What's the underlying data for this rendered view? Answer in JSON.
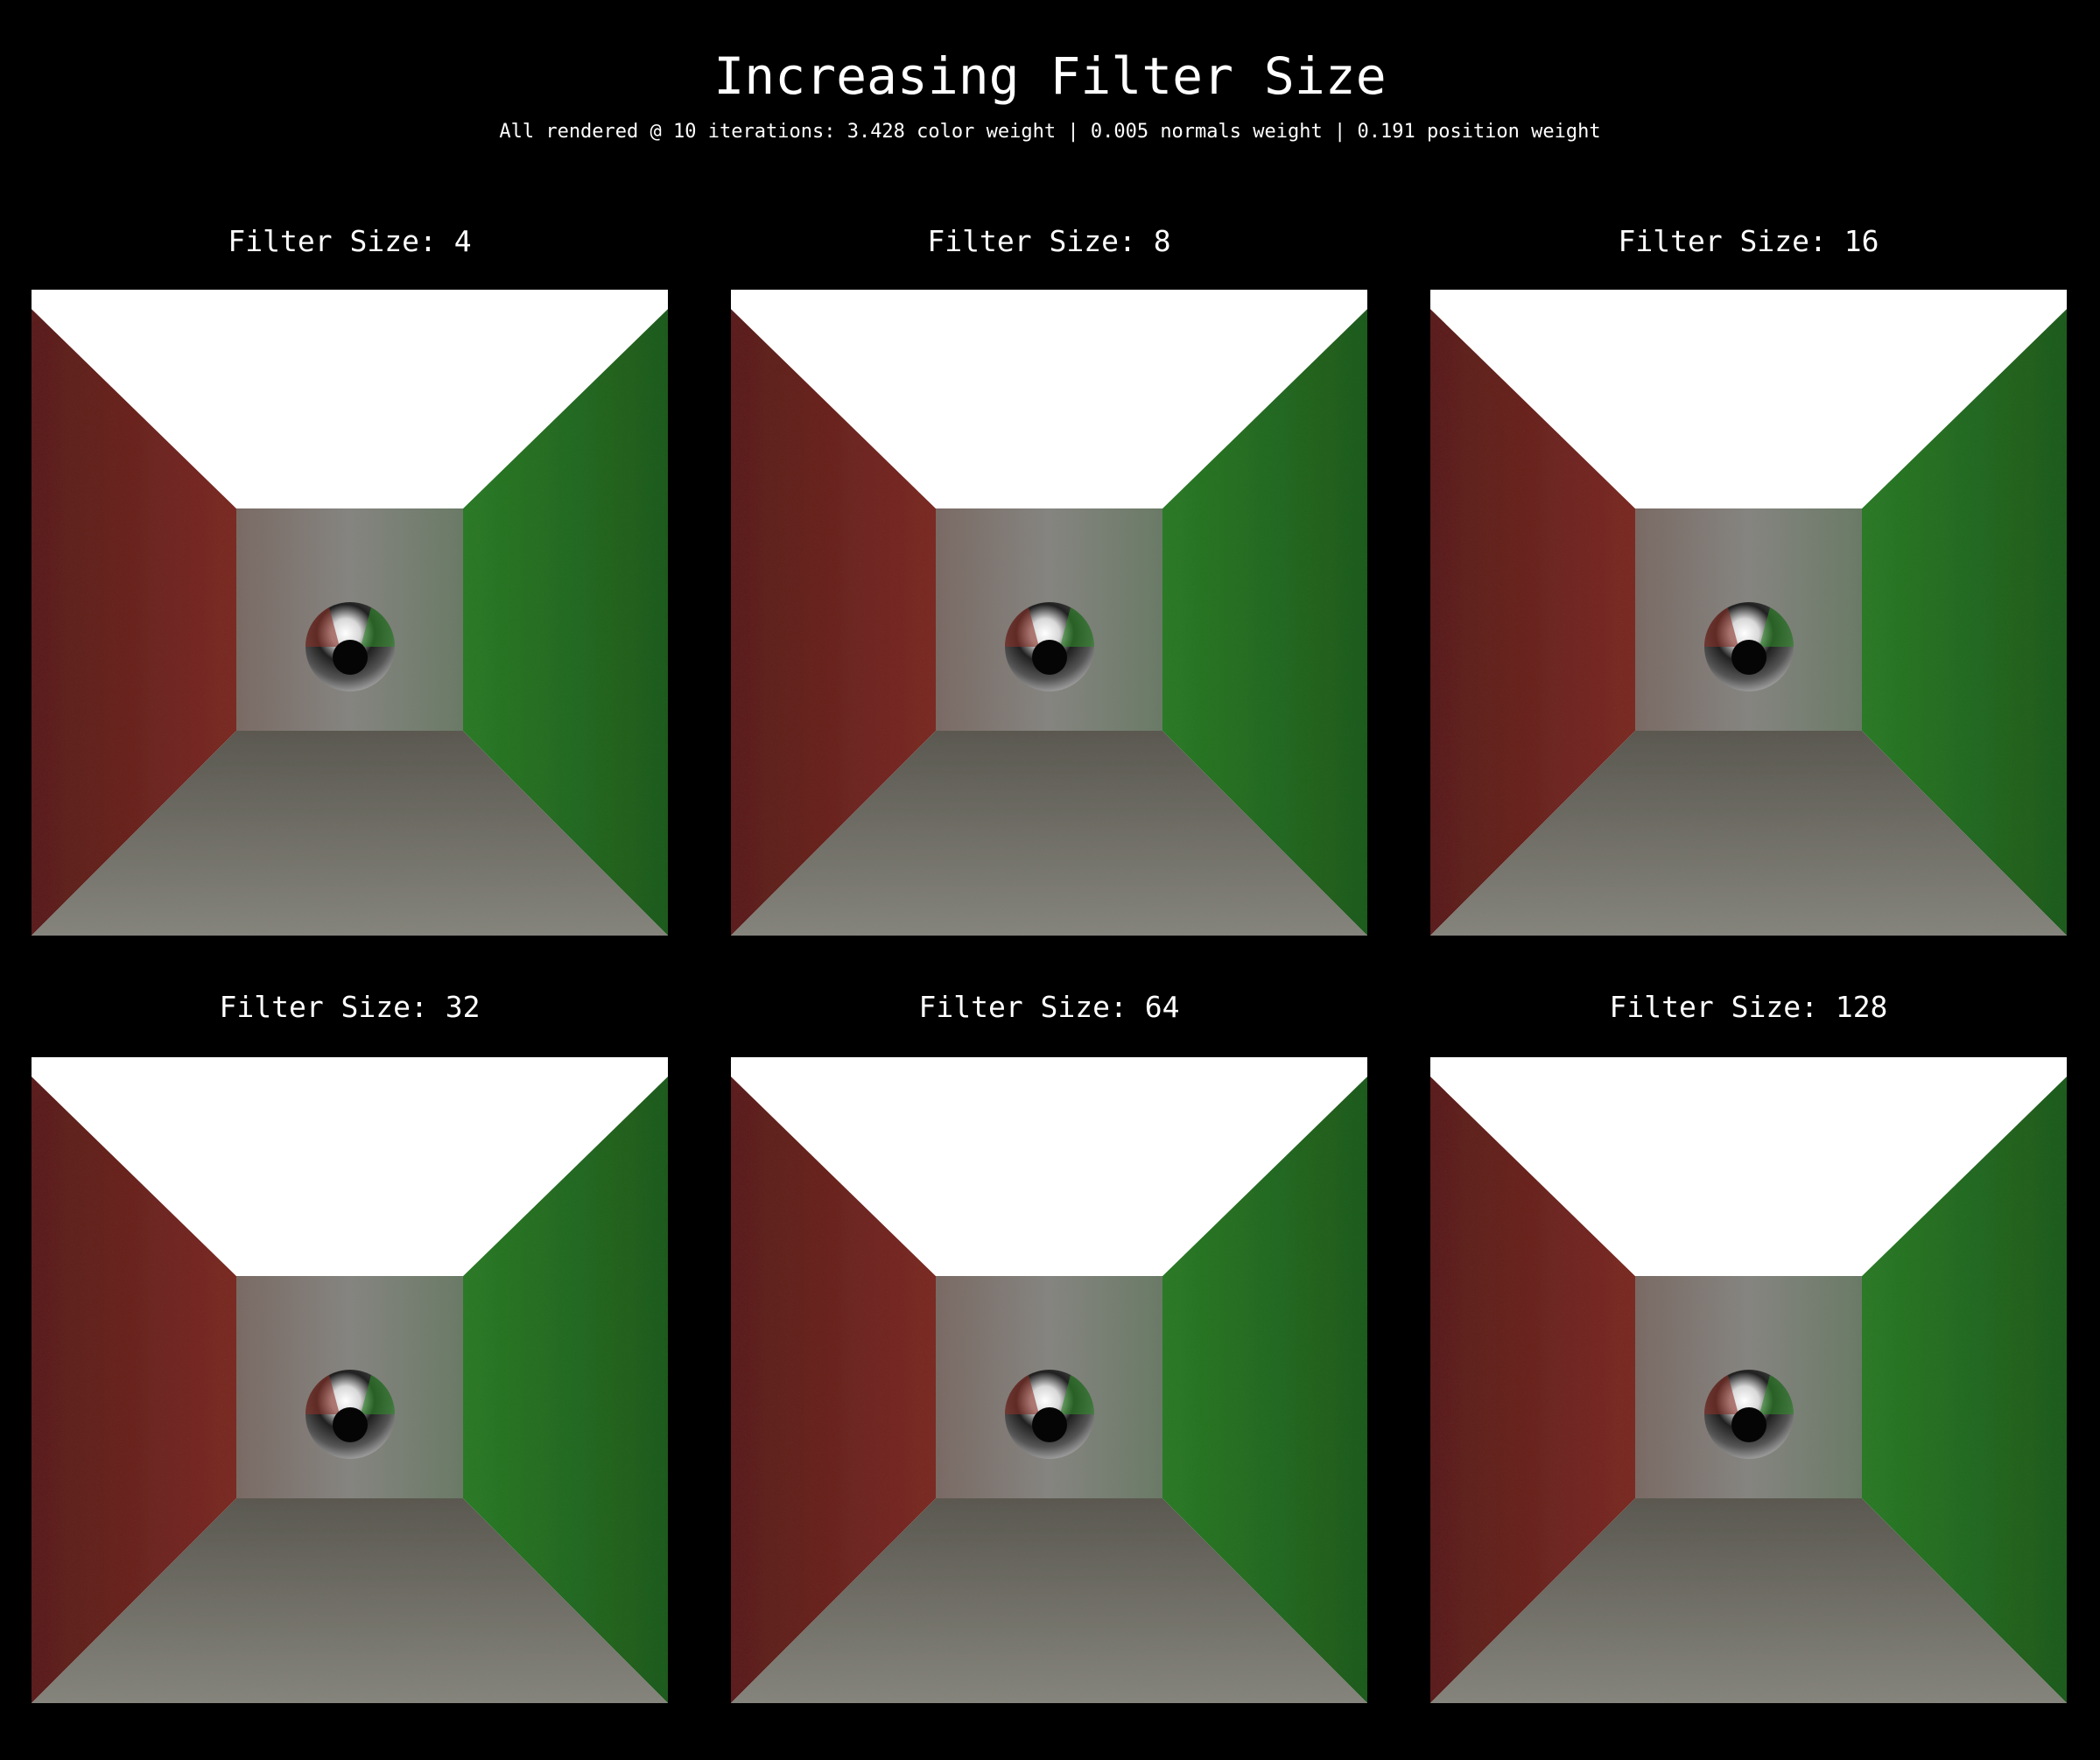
{
  "title": "Increasing Filter Size",
  "subtitle": "All rendered @ 10 iterations: 3.428 color weight | 0.005 normals weight | 0.191 position weight",
  "panels": [
    {
      "label": "Filter Size: 4",
      "filter_size": 4
    },
    {
      "label": "Filter Size: 8",
      "filter_size": 8
    },
    {
      "label": "Filter Size: 16",
      "filter_size": 16
    },
    {
      "label": "Filter Size: 32",
      "filter_size": 32
    },
    {
      "label": "Filter Size: 64",
      "filter_size": 64
    },
    {
      "label": "Filter Size: 128",
      "filter_size": 128
    }
  ],
  "colors": {
    "background": "#000000",
    "ceiling": "#ffffff",
    "left_wall": "#7a2a24",
    "right_wall": "#2a7a26",
    "back_wall": "#8a8a80",
    "floor": "#6a6a60"
  }
}
